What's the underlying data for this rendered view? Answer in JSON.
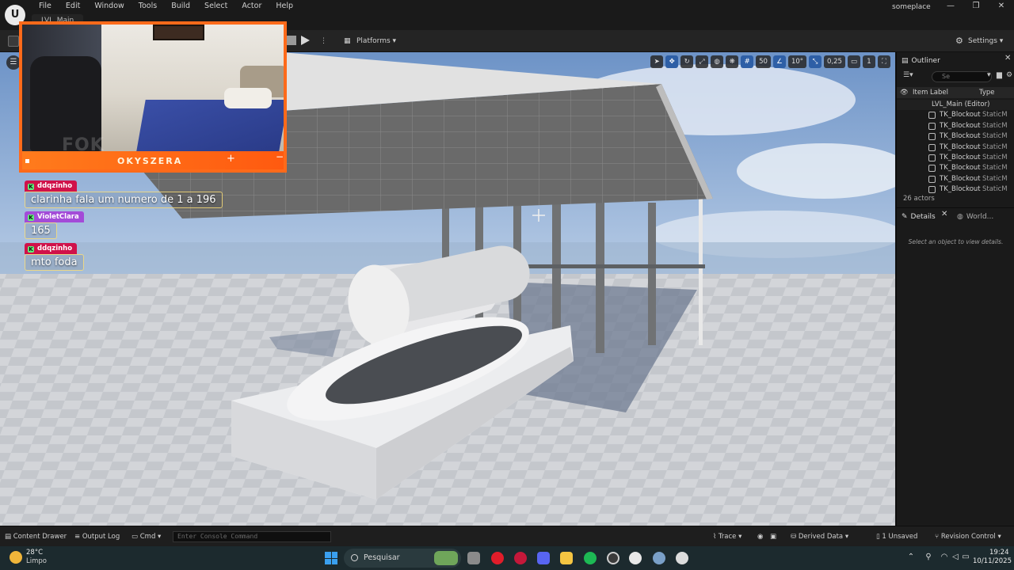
{
  "menubar": {
    "logo": "U",
    "items": [
      "File",
      "Edit",
      "Window",
      "Tools",
      "Build",
      "Select",
      "Actor",
      "Help"
    ],
    "level_tab": "LVL_Main",
    "project": "someplace",
    "window_controls": [
      "—",
      "❐",
      "✕"
    ]
  },
  "toolbar": {
    "platforms_label": "Platforms",
    "settings_label": "Settings"
  },
  "viewport": {
    "toolbar": [
      "50",
      "10°",
      "0,25",
      "1"
    ]
  },
  "stream": {
    "webcam_name": "OKYSZERA",
    "webcam_watermark": "FOK",
    "chat": [
      {
        "user": "ddqzinho",
        "color": "#d0124a",
        "text": "clarinha fala um numero de 1 a 196"
      },
      {
        "user": "VioletClara",
        "color": "#a34bd8",
        "text": "165"
      },
      {
        "user": "ddqzinho",
        "color": "#d0124a",
        "text": "mto foda"
      }
    ]
  },
  "outliner": {
    "title": "Outliner",
    "search_placeholder": "Se",
    "col_label": "Item Label",
    "col_type": "Type",
    "level_row": "LVL_Main (Editor)",
    "rows": [
      {
        "name": "TK_Blockout",
        "type": "StaticM"
      },
      {
        "name": "TK_Blockout",
        "type": "StaticM"
      },
      {
        "name": "TK_Blockout",
        "type": "StaticM"
      },
      {
        "name": "TK_Blockout",
        "type": "StaticM"
      },
      {
        "name": "TK_Blockout",
        "type": "StaticM"
      },
      {
        "name": "TK_Blockout",
        "type": "StaticM"
      },
      {
        "name": "TK_Blockout",
        "type": "StaticM"
      },
      {
        "name": "TK_Blockout",
        "type": "StaticM"
      }
    ],
    "count": "26 actors"
  },
  "details": {
    "tab_details": "Details",
    "tab_world": "World...",
    "empty_text": "Select an object to view details."
  },
  "statusbar": {
    "content_drawer": "Content Drawer",
    "output_log": "Output Log",
    "cmd": "Cmd",
    "console_placeholder": "Enter Console Command",
    "trace": "Trace",
    "derived_data": "Derived Data",
    "unsaved": "1 Unsaved",
    "revision_control": "Revision Control"
  },
  "taskbar": {
    "temperature": "28°C",
    "weather": "Limpo",
    "search": "Pesquisar",
    "time": "19:24",
    "date": "10/11/2025"
  },
  "colors": {
    "accent": "#2e5fa6",
    "webcam_border": "#ff6a1a",
    "sky": "#8fb1d8",
    "floor": "#d6d8dc"
  }
}
